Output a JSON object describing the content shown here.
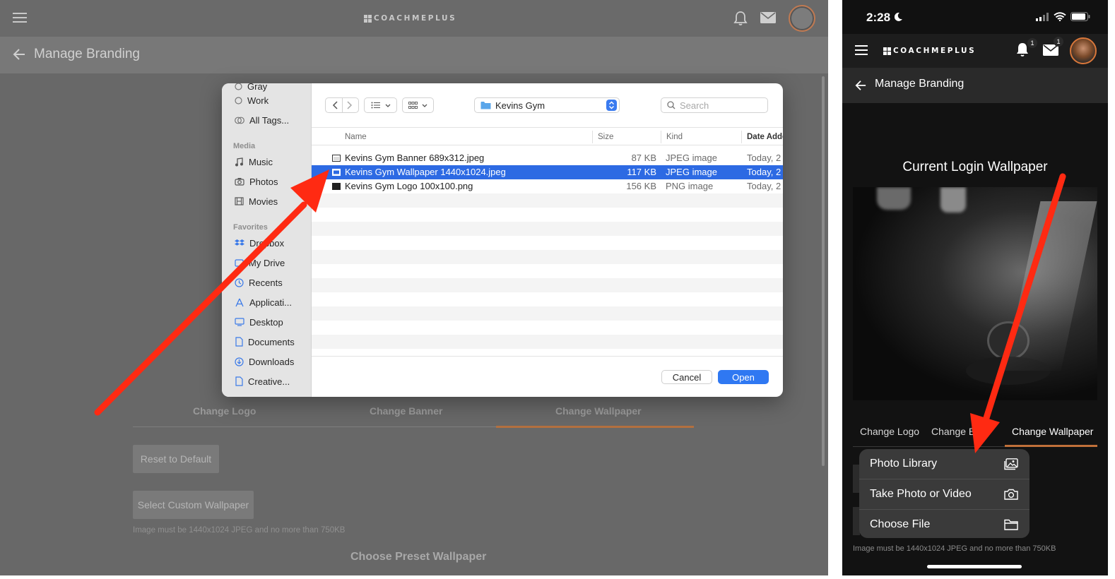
{
  "desktop": {
    "brand": "COACHMEPLUS",
    "page_title": "Manage Branding",
    "tabs": [
      {
        "label": "Change Logo"
      },
      {
        "label": "Change Banner"
      },
      {
        "label": "Change Wallpaper"
      }
    ],
    "reset_label": "Reset to Default",
    "select_label": "Select Custom Wallpaper",
    "note": "Image must be 1440x1024 JPEG and no more than 750KB",
    "preset_title": "Choose Preset Wallpaper",
    "colors": {
      "accent": "#b3703f"
    }
  },
  "dialog": {
    "sidebar": {
      "partial_top": "Gray",
      "tags": [
        {
          "label": "Work",
          "icon": "tag-circle-icon"
        },
        {
          "label": "All Tags...",
          "icon": "tags-icon"
        }
      ],
      "media_header": "Media",
      "media": [
        {
          "label": "Music",
          "icon": "music-note-icon"
        },
        {
          "label": "Photos",
          "icon": "camera-icon"
        },
        {
          "label": "Movies",
          "icon": "film-icon"
        }
      ],
      "favorites_header": "Favorites",
      "favorites": [
        {
          "label": "Dropbox",
          "icon": "dropbox-icon"
        },
        {
          "label": "My Drive",
          "icon": "drive-icon"
        },
        {
          "label": "Recents",
          "icon": "clock-icon"
        },
        {
          "label": "Applicati...",
          "icon": "applications-icon"
        },
        {
          "label": "Desktop",
          "icon": "desktop-icon"
        },
        {
          "label": "Documents",
          "icon": "document-icon"
        },
        {
          "label": "Downloads",
          "icon": "download-icon"
        },
        {
          "label": "Creative...",
          "icon": "file-icon"
        }
      ]
    },
    "location": "Kevins Gym",
    "search_placeholder": "Search",
    "columns": {
      "name": "Name",
      "size": "Size",
      "kind": "Kind",
      "date": "Date Added"
    },
    "files": [
      {
        "name": "Kevins Gym Banner 689x312.jpeg",
        "size": "87 KB",
        "kind": "JPEG image",
        "date": "Today, 2",
        "selected": false
      },
      {
        "name": "Kevins Gym Wallpaper 1440x1024.jpeg",
        "size": "117 KB",
        "kind": "JPEG image",
        "date": "Today, 2",
        "selected": true
      },
      {
        "name": "Kevins Gym Logo 100x100.png",
        "size": "156 KB",
        "kind": "PNG image",
        "date": "Today, 2",
        "selected": false
      }
    ],
    "cancel_label": "Cancel",
    "open_label": "Open",
    "colors": {
      "selection": "#2d6ae3",
      "primary": "#2f78f2"
    }
  },
  "phone": {
    "time": "2:28",
    "brand": "COACHMEPLUS",
    "bell_badge": "1",
    "mail_badge": "1",
    "page_title": "Manage Branding",
    "wallpaper_title": "Current Login Wallpaper",
    "tabs": [
      {
        "label": "Change Logo"
      },
      {
        "label": "Change B"
      },
      {
        "label": "Change Wallpaper"
      }
    ],
    "menu": [
      {
        "label": "Photo Library",
        "icon": "photo-library-icon"
      },
      {
        "label": "Take Photo or Video",
        "icon": "camera-icon"
      },
      {
        "label": "Choose File",
        "icon": "folder-icon"
      }
    ],
    "note": "Image must be 1440x1024 JPEG and no more than 750KB",
    "colors": {
      "accent": "#c0703a"
    }
  },
  "annotation": {
    "arrow_color": "#ff2a12"
  }
}
